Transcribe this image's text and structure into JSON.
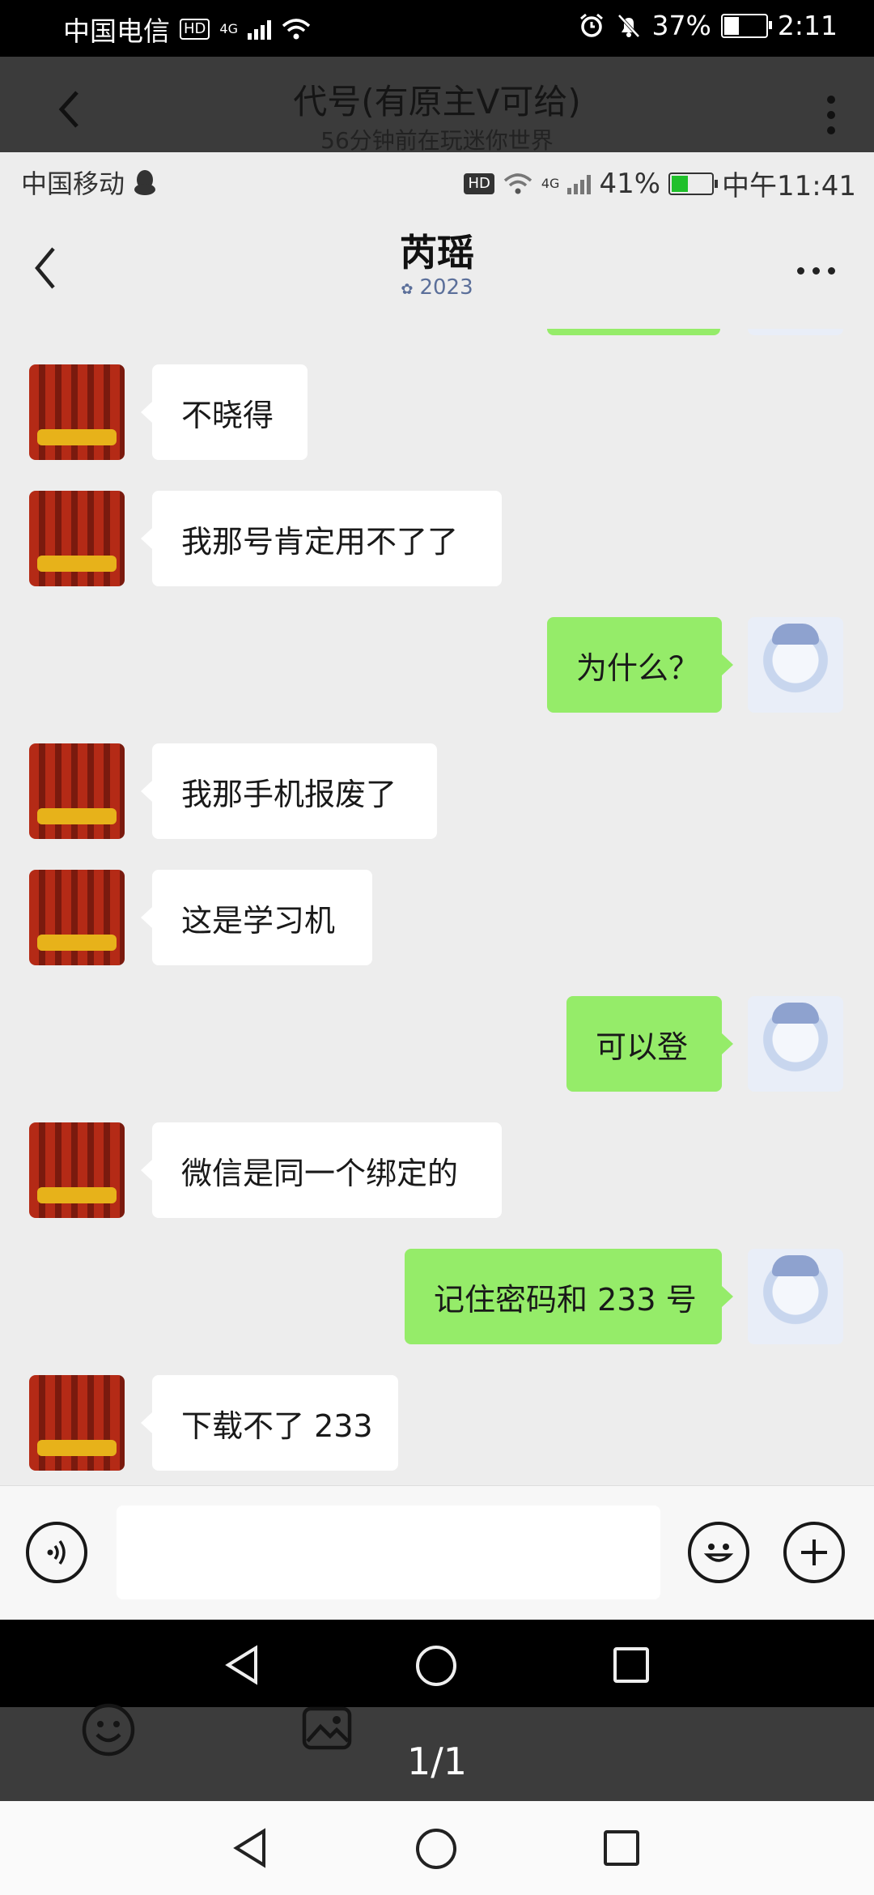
{
  "outer_status": {
    "carrier": "中国电信",
    "hd": "HD",
    "network": "4G",
    "battery_percent": "37%",
    "time": "2:11"
  },
  "outer_header": {
    "title": "代号(有原主V可给)",
    "subtitle": "56分钟前在玩迷你世界"
  },
  "inner_status": {
    "carrier": "中国移动",
    "hd": "HD",
    "network": "4G",
    "battery_percent": "41%",
    "time": "中午11:41"
  },
  "chat": {
    "title": "芮瑶",
    "subtitle": "2023"
  },
  "messages": [
    {
      "side": "left",
      "text": "不晓得"
    },
    {
      "side": "left",
      "text": "我那号肯定用不了了"
    },
    {
      "side": "right",
      "text": "为什么？"
    },
    {
      "side": "left",
      "text": "我那手机报废了"
    },
    {
      "side": "left",
      "text": "这是学习机"
    },
    {
      "side": "right",
      "text": "可以登"
    },
    {
      "side": "left",
      "text": "微信是同一个绑定的"
    },
    {
      "side": "right",
      "text": "记住密码和 233 号"
    },
    {
      "side": "left",
      "text": "下载不了 233"
    }
  ],
  "input": {
    "value": ""
  },
  "viewer": {
    "page_indicator": "1/1"
  },
  "colors": {
    "bubble_right": "#95ec69",
    "bubble_left": "#ffffff",
    "chat_bg": "#ededed"
  },
  "icons": {
    "voice": "voice-icon",
    "emoji": "emoji-icon",
    "plus": "plus-icon",
    "back": "back-arrow-icon",
    "more": "more-icon"
  }
}
